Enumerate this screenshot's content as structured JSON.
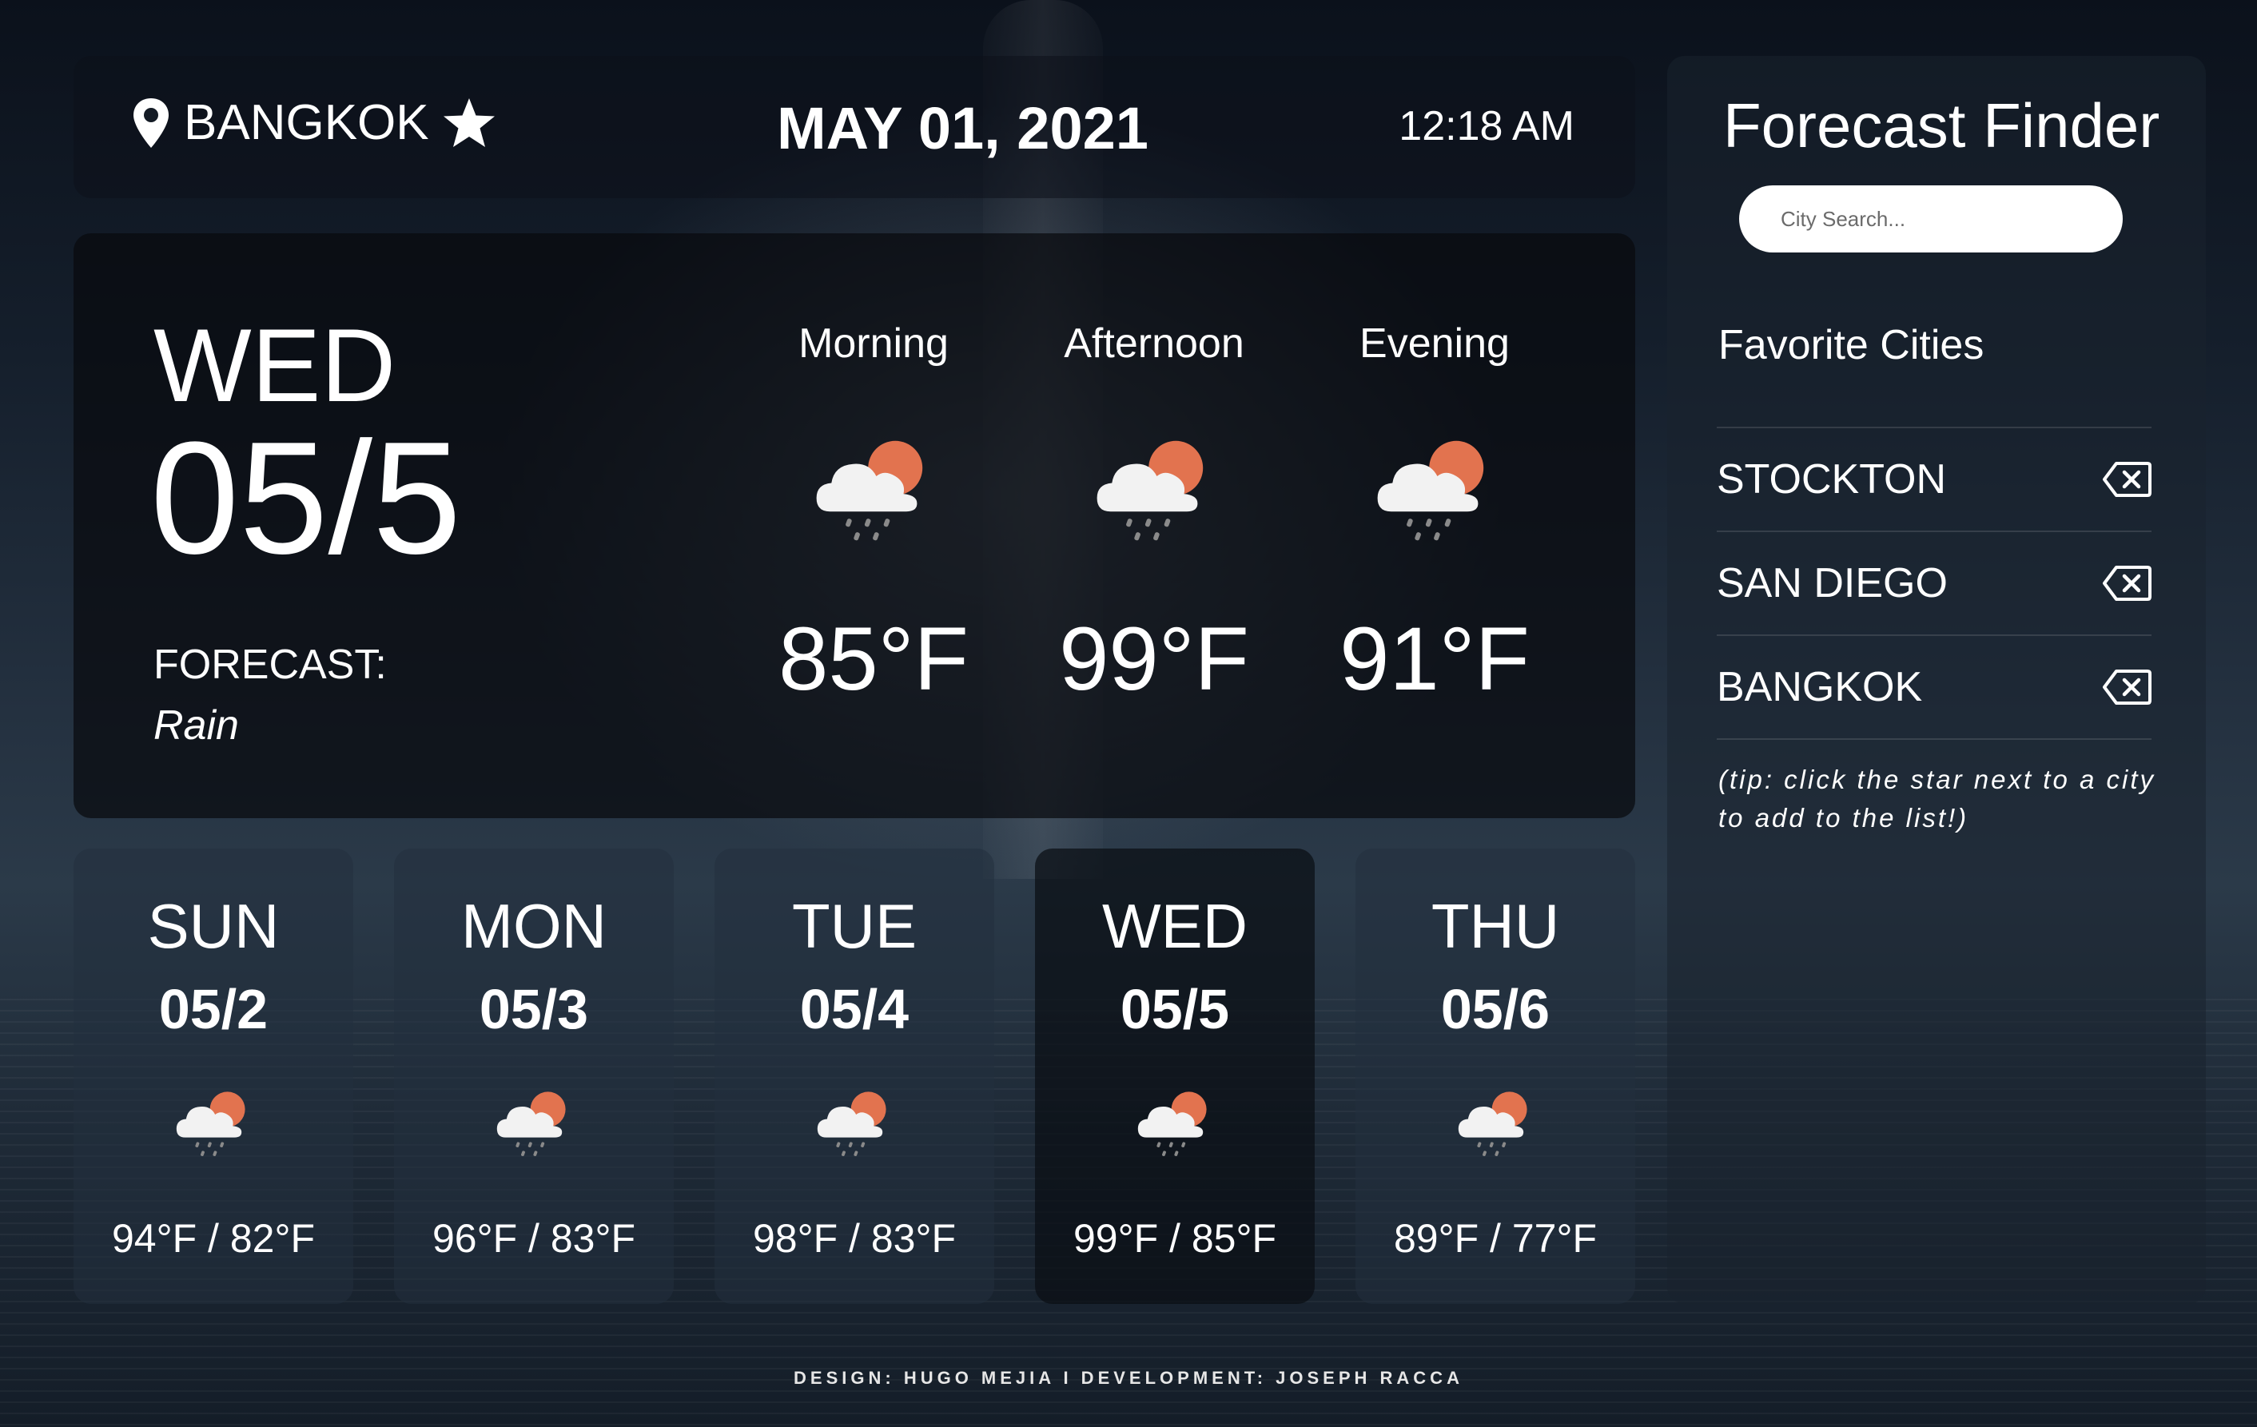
{
  "header": {
    "city": "BANGKOK",
    "date": "MAY 01, 2021",
    "time": "12:18 AM"
  },
  "today": {
    "day": "WED",
    "date": "05/5",
    "forecast_label": "FORECAST:",
    "forecast_value": "Rain",
    "periods": [
      {
        "label": "Morning",
        "temp": "85°F",
        "icon": "rain-cloud-sun-icon"
      },
      {
        "label": "Afternoon",
        "temp": "99°F",
        "icon": "rain-cloud-sun-icon"
      },
      {
        "label": "Evening",
        "temp": "91°F",
        "icon": "rain-cloud-sun-icon"
      }
    ]
  },
  "days": [
    {
      "day": "SUN",
      "date": "05/2",
      "temps": "94°F / 82°F",
      "icon": "rain-cloud-sun-icon"
    },
    {
      "day": "MON",
      "date": "05/3",
      "temps": "96°F / 83°F",
      "icon": "rain-cloud-sun-icon"
    },
    {
      "day": "TUE",
      "date": "05/4",
      "temps": "98°F / 83°F",
      "icon": "rain-cloud-sun-icon"
    },
    {
      "day": "WED",
      "date": "05/5",
      "temps": "99°F / 85°F",
      "icon": "rain-cloud-sun-icon",
      "selected": true
    },
    {
      "day": "THU",
      "date": "05/6",
      "temps": "89°F / 77°F",
      "icon": "rain-cloud-sun-icon"
    }
  ],
  "sidebar": {
    "title": "Forecast Finder",
    "search_placeholder": "City Search...",
    "favorites_title": "Favorite Cities",
    "favorites": [
      "STOCKTON",
      "SAN DIEGO",
      "BANGKOK"
    ],
    "tip": "(tip: click the star next to a city to add to the list!)"
  },
  "footer": "DESIGN: HUGO MEJIA I DEVELOPMENT: JOSEPH RACCA",
  "colors": {
    "sun": "#e2734f",
    "cloud": "#f2f2f2",
    "rain": "#8a8a8a"
  }
}
